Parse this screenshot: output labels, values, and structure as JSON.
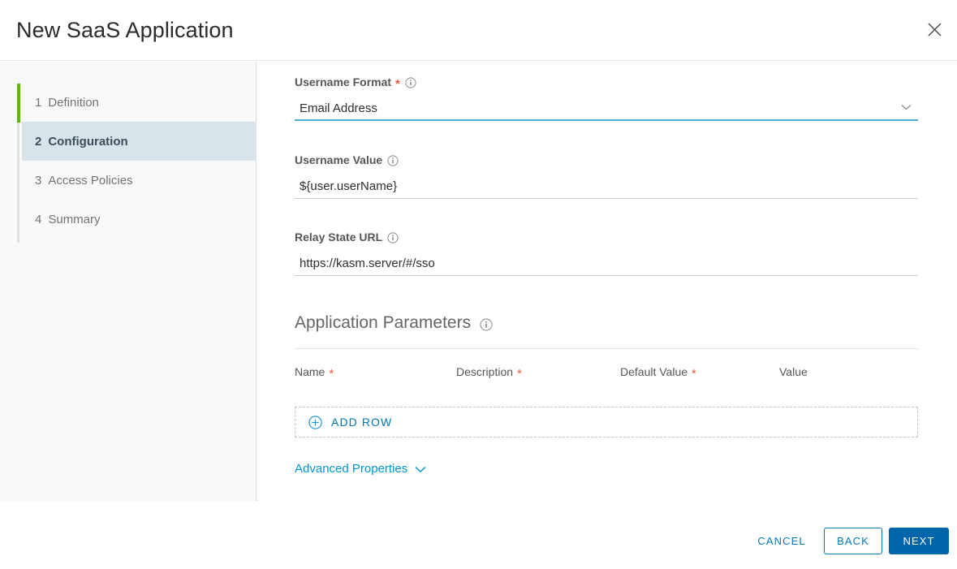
{
  "header": {
    "title": "New SaaS Application",
    "close_icon": "close-icon"
  },
  "sidebar": {
    "steps": [
      {
        "num": "1",
        "label": "Definition",
        "state": "completed"
      },
      {
        "num": "2",
        "label": "Configuration",
        "state": "active"
      },
      {
        "num": "3",
        "label": "Access Policies",
        "state": "upcoming"
      },
      {
        "num": "4",
        "label": "Summary",
        "state": "upcoming"
      }
    ],
    "accent_done_color": "#60b515",
    "active_bg_color": "#d8e3ea"
  },
  "form": {
    "username_format": {
      "label": "Username Format",
      "required_mark": "*",
      "info_icon": "info-icon",
      "value": "Email Address",
      "chevron_icon": "chevron-down-icon",
      "focus_color": "#49afd9"
    },
    "username_value": {
      "label": "Username Value",
      "info_icon": "info-icon",
      "value": "${user.userName}"
    },
    "relay_state_url": {
      "label": "Relay State URL",
      "info_icon": "info-icon",
      "value": "https://kasm.server/#/sso"
    },
    "application_parameters": {
      "title": "Application Parameters",
      "info_icon": "info-icon",
      "columns": [
        {
          "label": "Name",
          "required_mark": "*"
        },
        {
          "label": "Description",
          "required_mark": "*"
        },
        {
          "label": "Default Value",
          "required_mark": "*"
        },
        {
          "label": "Value",
          "required_mark": ""
        }
      ],
      "rows": [],
      "add_row_label": "ADD ROW",
      "add_row_icon": "plus-circle-icon"
    },
    "advanced_properties": {
      "label": "Advanced Properties",
      "chevron_icon": "chevron-down-icon"
    }
  },
  "footer": {
    "cancel_label": "CANCEL",
    "back_label": "BACK",
    "next_label": "NEXT",
    "primary_color": "#0065ab",
    "link_color": "#0079b8"
  }
}
